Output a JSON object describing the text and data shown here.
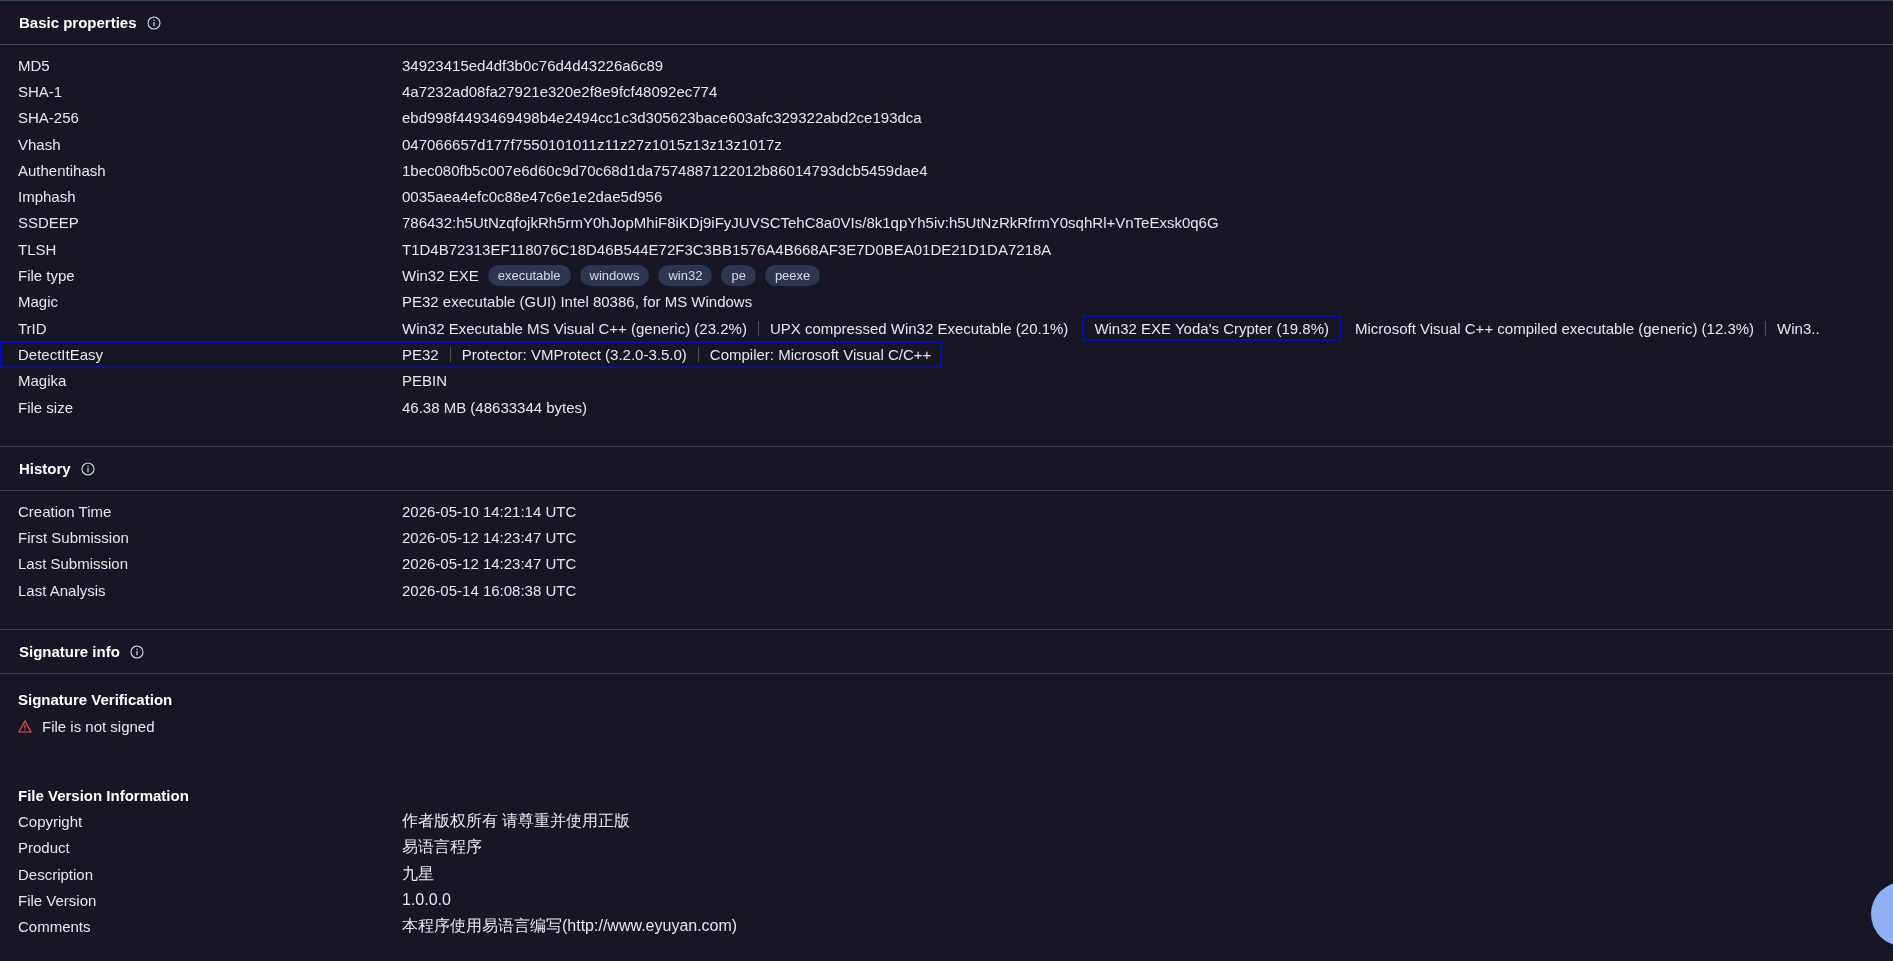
{
  "sections": [
    {
      "title": "Basic properties",
      "kind": "properties",
      "rows": [
        {
          "label": "MD5",
          "kind": "text",
          "highlighted": false,
          "value": "34923415ed4df3b0c76d4d43226a6c89"
        },
        {
          "label": "SHA-1",
          "kind": "text",
          "highlighted": false,
          "value": "4a7232ad08fa27921e320e2f8e9fcf48092ec774"
        },
        {
          "label": "SHA-256",
          "kind": "text",
          "highlighted": false,
          "value": "ebd998f4493469498b4e2494cc1c3d305623bace603afc329322abd2ce193dca"
        },
        {
          "label": "Vhash",
          "kind": "text",
          "highlighted": false,
          "value": "047066657d177f7550101011z11z27z1015z13z13z1017z"
        },
        {
          "label": "Authentihash",
          "kind": "text",
          "highlighted": false,
          "value": "1bec080fb5c007e6d60c9d70c68d1da7574887122012b86014793dcb5459dae4"
        },
        {
          "label": "Imphash",
          "kind": "text",
          "highlighted": false,
          "value": "0035aea4efc0c88e47c6e1e2dae5d956"
        },
        {
          "label": "SSDEEP",
          "kind": "text",
          "highlighted": false,
          "value": "786432:h5UtNzqfojkRh5rmY0hJopMhiF8iKDj9iFyJUVSCTehC8a0VIs/8k1qpYh5iv:h5UtNzRkRfrmY0sqhRl+VnTeExsk0q6G"
        },
        {
          "label": "TLSH",
          "kind": "text",
          "highlighted": false,
          "value": "T1D4B72313EF118076C18D46B544E72F3C3BB1576A4B668AF3E7D0BEA01DE21D1DA7218A"
        },
        {
          "label": "File type",
          "kind": "tags",
          "highlighted": false,
          "value": "Win32 EXE",
          "tags": [
            "executable",
            "windows",
            "win32",
            "pe",
            "peexe"
          ]
        },
        {
          "label": "Magic",
          "kind": "text",
          "highlighted": false,
          "value": "PE32 executable (GUI) Intel 80386, for MS Windows"
        },
        {
          "label": "TrID",
          "kind": "list",
          "highlighted": false,
          "items": [
            {
              "text": "Win32 Executable MS Visual C++ (generic) (23.2%)",
              "highlighted": false
            },
            {
              "text": "UPX compressed Win32 Executable (20.1%)",
              "highlighted": false
            },
            {
              "text": "Win32 EXE Yoda's Crypter (19.8%)",
              "highlighted": true
            },
            {
              "text": "Microsoft Visual C++ compiled executable (generic) (12.3%)",
              "highlighted": false
            },
            {
              "text": "Win3..",
              "highlighted": false
            }
          ]
        },
        {
          "label": "DetectItEasy",
          "kind": "list",
          "highlighted": true,
          "items": [
            {
              "text": "PE32",
              "highlighted": false
            },
            {
              "text": "Protector: VMProtect (3.2.0-3.5.0)",
              "highlighted": false
            },
            {
              "text": "Compiler: Microsoft Visual C/C++",
              "highlighted": false
            }
          ]
        },
        {
          "label": "Magika",
          "kind": "text",
          "highlighted": false,
          "value": "PEBIN"
        },
        {
          "label": "File size",
          "kind": "text",
          "highlighted": false,
          "value": "46.38 MB (48633344 bytes)"
        }
      ]
    },
    {
      "title": "History",
      "kind": "properties",
      "rows": [
        {
          "label": "Creation Time",
          "kind": "text",
          "highlighted": false,
          "value": "2026-05-10 14:21:14 UTC"
        },
        {
          "label": "First Submission",
          "kind": "text",
          "highlighted": false,
          "value": "2026-05-12 14:23:47 UTC"
        },
        {
          "label": "Last Submission",
          "kind": "text",
          "highlighted": false,
          "value": "2026-05-12 14:23:47 UTC"
        },
        {
          "label": "Last Analysis",
          "kind": "text",
          "highlighted": false,
          "value": "2026-05-14 16:08:38 UTC"
        }
      ]
    },
    {
      "title": "Signature info",
      "kind": "blocks",
      "blocks": [
        {
          "heading": "Signature Verification",
          "kind": "status",
          "signed": false,
          "text": "File is not signed"
        },
        {
          "heading": "File Version Information",
          "kind": "table",
          "rows": [
            {
              "label": "Copyright",
              "value": "作者版权所有 请尊重并使用正版"
            },
            {
              "label": "Product",
              "value": "易语言程序"
            },
            {
              "label": "Description",
              "value": "九星"
            },
            {
              "label": "File Version",
              "value": "1.0.0.0"
            },
            {
              "label": "Comments",
              "value": "本程序使用易语言编写(http://www.eyuyan.com)"
            }
          ]
        }
      ]
    }
  ]
}
